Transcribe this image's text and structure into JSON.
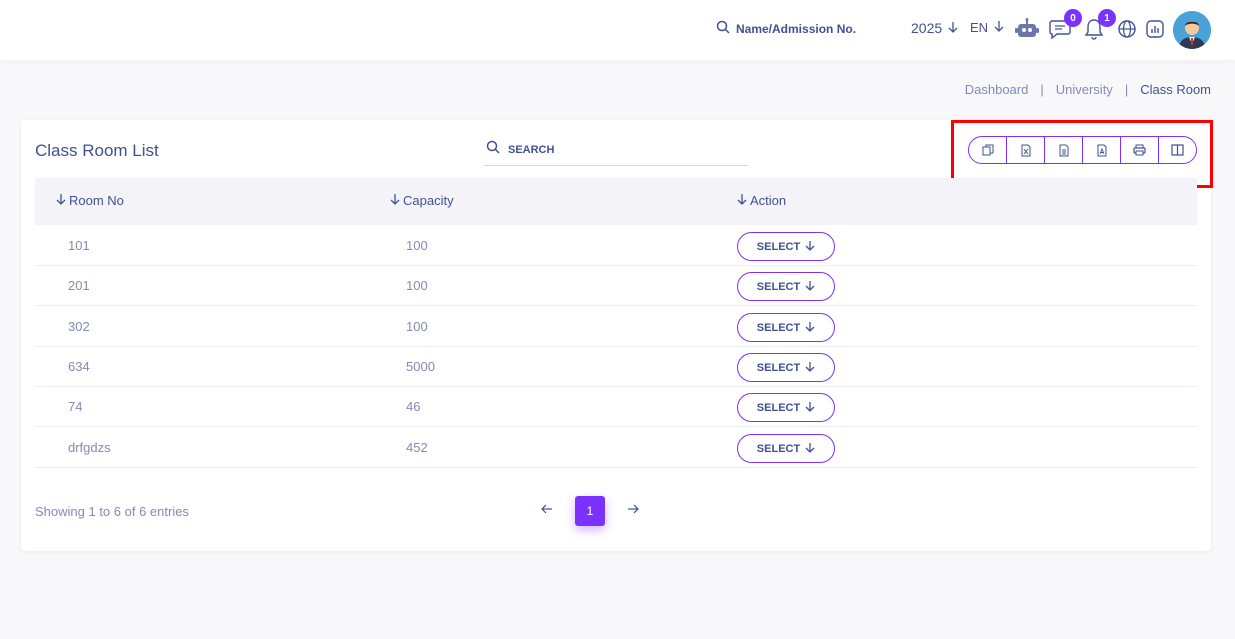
{
  "header": {
    "search_placeholder": "Name/Admission No.",
    "year": "2025",
    "language": "EN",
    "chat_badge": "0",
    "notification_badge": "1",
    "accent_color": "#7c32ff"
  },
  "breadcrumb": {
    "items": [
      "Dashboard",
      "University",
      "Class Room"
    ],
    "separator": "|"
  },
  "card": {
    "title": "Class Room List",
    "search_placeholder": "SEARCH",
    "export_buttons": [
      "copy-icon",
      "excel-icon",
      "csv-icon",
      "pdf-icon",
      "print-icon",
      "columns-icon"
    ]
  },
  "table": {
    "columns": [
      "Room No",
      "Capacity",
      "Action"
    ],
    "action_label": "SELECT",
    "rows": [
      {
        "room_no": "101",
        "capacity": "100"
      },
      {
        "room_no": "201",
        "capacity": "100"
      },
      {
        "room_no": "302",
        "capacity": "100"
      },
      {
        "room_no": "634",
        "capacity": "5000"
      },
      {
        "room_no": "74",
        "capacity": "46"
      },
      {
        "room_no": "drfgdzs",
        "capacity": "452"
      }
    ]
  },
  "footer": {
    "showing_text": "Showing 1 to 6 of 6 entries",
    "current_page": "1"
  }
}
